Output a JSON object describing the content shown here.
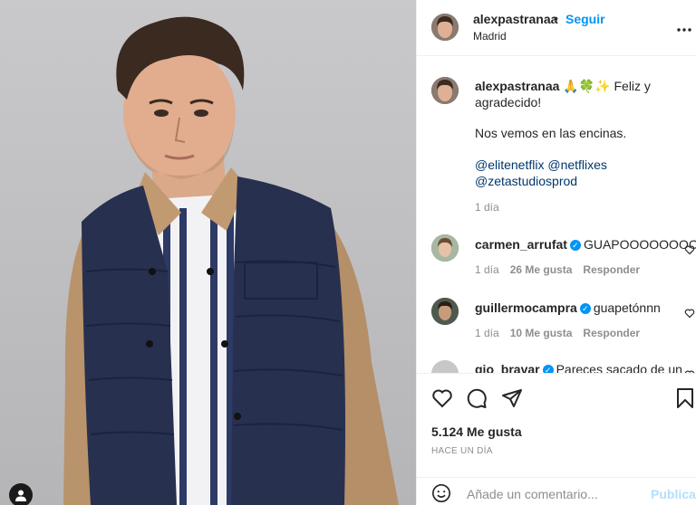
{
  "header": {
    "username": "alexpastranaa",
    "dot": "•",
    "follow_label": "Seguir",
    "location": "Madrid",
    "more_icon": "more-horizontal-icon"
  },
  "caption": {
    "username": "alexpastranaa",
    "emojis": "🙏🍀✨",
    "line1": "Feliz y agradecido!",
    "line2": "Nos vemos en las encinas.",
    "mention1": "@elitenetflix",
    "mention2": "@netflixes",
    "mention3": "@zetastudiosprod",
    "time": "1 día"
  },
  "comments": [
    {
      "username": "carmen_arrufat",
      "verified": true,
      "text": "GUAPOOOOOOOO",
      "time": "1 día",
      "likes": "26 Me gusta",
      "reply": "Responder"
    },
    {
      "username": "guillermocampra",
      "verified": true,
      "text": "guapetónnn",
      "time": "1 día",
      "likes": "10 Me gusta",
      "reply": "Responder"
    },
    {
      "username": "gio_bravar",
      "verified": true,
      "text": "Pareces sacado de un"
    }
  ],
  "actions": {
    "likes": "5.124 Me gusta",
    "post_time": "HACE UN DÍA"
  },
  "add_comment": {
    "placeholder": "Añade un comentario...",
    "publish_label": "Publicar"
  },
  "colors": {
    "accent": "#0095f6",
    "mention": "#00376b",
    "muted": "#8e8e8e"
  }
}
